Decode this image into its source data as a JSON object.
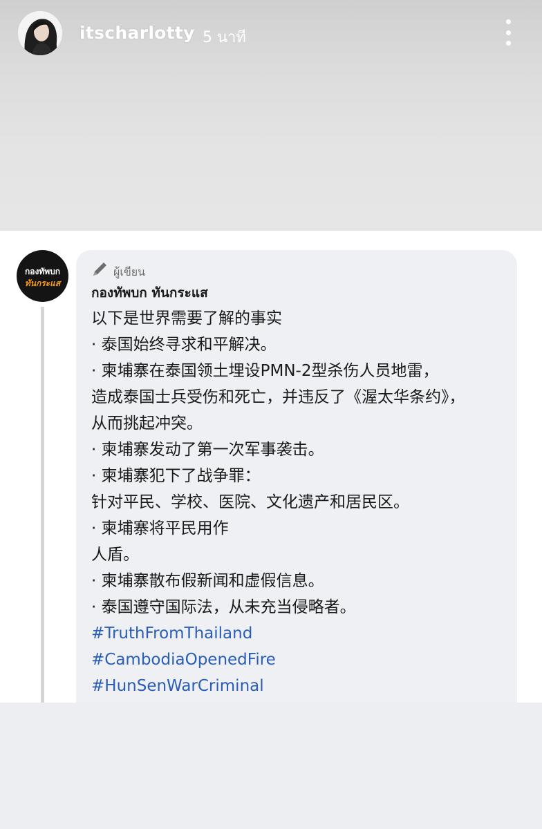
{
  "story": {
    "username": "itscharlotty",
    "timestamp": "5 นาที"
  },
  "post": {
    "role_label": "ผู้เขียน",
    "author_name": "กองทัพบก ทันกระแส",
    "page_avatar": {
      "line1": "กองทัพบก",
      "line2": "ทันกระแส"
    },
    "lines": [
      "以下是世界需要了解的事实",
      "· 泰国始终寻求和平解决。",
      "· 柬埔寨在泰国领土埋设PMN-2型杀伤人员地雷，",
      "造成泰国士兵受伤和死亡，并违反了《渥太华条约》，",
      "从而挑起冲突。",
      "· 柬埔寨发动了第一次军事袭击。",
      "· 柬埔寨犯下了战争罪：",
      "针对平民、学校、医院、文化遗产和居民区。",
      "· 柬埔寨将平民用作",
      "人盾。",
      "· 柬埔寨散布假新闻和虚假信息。",
      "· 泰国遵守国际法，从未充当侵略者。"
    ],
    "hashtags": [
      "#TruthFromThailand",
      "#CambodiaOpenedFire",
      "#HunSenWarCriminal"
    ]
  },
  "colors": {
    "hashtag": "#2a5db5",
    "logo_accent": "#f39a1a",
    "bubble_bg": "#eef0f3"
  },
  "icons": [
    "more-vertical-icon",
    "pen-icon"
  ]
}
